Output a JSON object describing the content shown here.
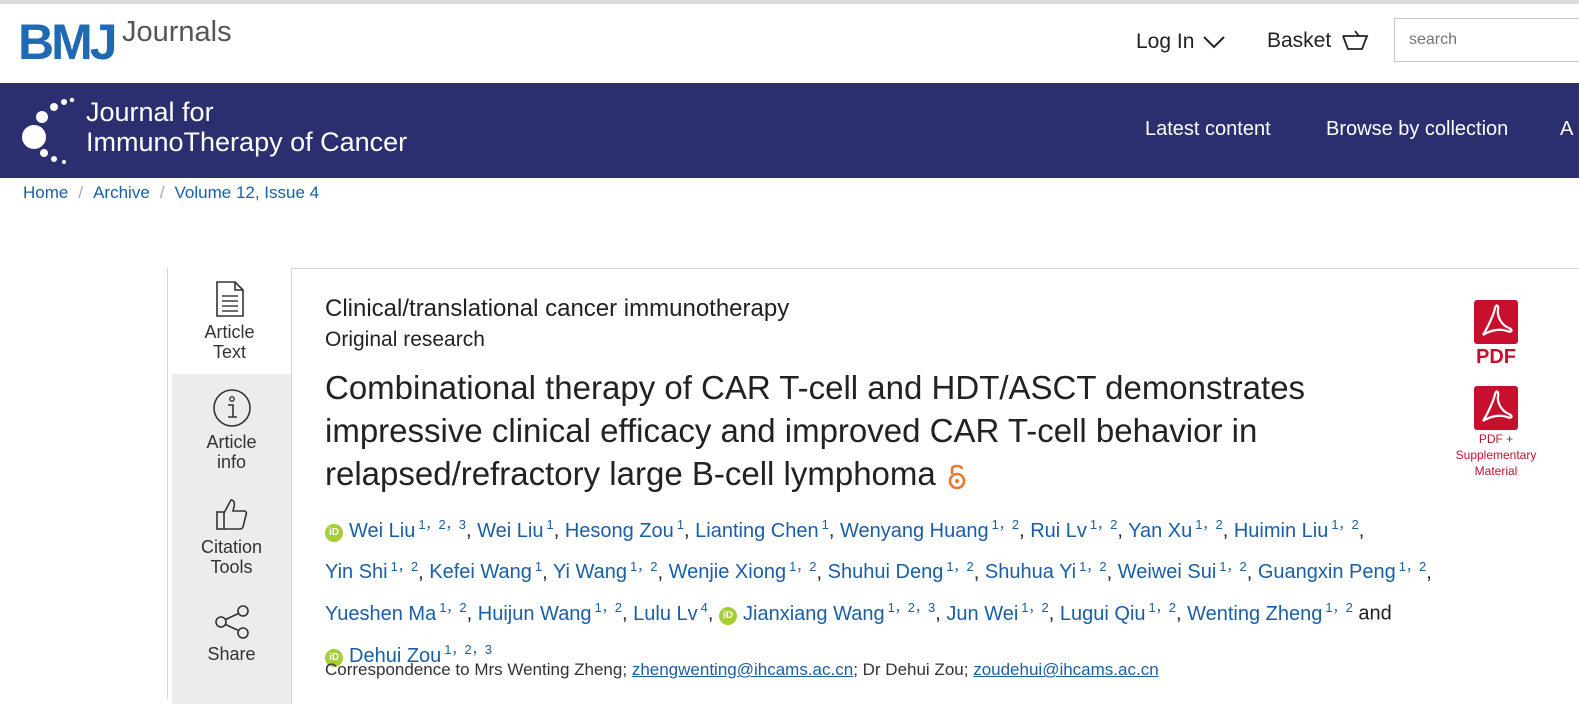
{
  "header": {
    "brand": "BMJ",
    "brand_suffix": "Journals",
    "login_label": "Log In",
    "basket_label": "Basket",
    "search_placeholder": "search"
  },
  "journal": {
    "title_line1": "Journal for",
    "title_line2": "ImmunoTherapy of Cancer",
    "nav": [
      "Latest content",
      "Browse by collection",
      "A"
    ]
  },
  "breadcrumb": [
    "Home",
    "Archive",
    "Volume 12, Issue 4"
  ],
  "sidebar": {
    "tabs": [
      {
        "line1": "Article",
        "line2": "Text",
        "icon": "document-icon"
      },
      {
        "line1": "Article",
        "line2": "info",
        "icon": "info-icon"
      },
      {
        "line1": "Citation",
        "line2": "Tools",
        "icon": "thumbs-up-icon"
      },
      {
        "line1": "Share",
        "line2": "",
        "icon": "share-icon"
      }
    ]
  },
  "article": {
    "section": "Clinical/translational cancer immunotherapy",
    "type": "Original research",
    "title": "Combinational therapy of CAR T-cell and HDT/ASCT demonstrates impressive clinical efficacy and improved CAR T-cell behavior in relapsed/refractory large B-cell lymphoma",
    "authors": [
      {
        "name": "Wei Liu",
        "aff": "1，2，3",
        "orcid": true
      },
      {
        "name": "Wei Liu",
        "aff": "1",
        "orcid": false
      },
      {
        "name": "Hesong Zou",
        "aff": "1",
        "orcid": false
      },
      {
        "name": "Lianting Chen",
        "aff": "1",
        "orcid": false
      },
      {
        "name": "Wenyang Huang",
        "aff": "1，2",
        "orcid": false
      },
      {
        "name": "Rui Lv",
        "aff": "1，2",
        "orcid": false
      },
      {
        "name": "Yan Xu",
        "aff": "1，2",
        "orcid": false
      },
      {
        "name": "Huimin Liu",
        "aff": "1，2",
        "orcid": false
      },
      {
        "name": "Yin Shi",
        "aff": "1，2",
        "orcid": false
      },
      {
        "name": "Kefei Wang",
        "aff": "1",
        "orcid": false
      },
      {
        "name": "Yi Wang",
        "aff": "1，2",
        "orcid": false
      },
      {
        "name": "Wenjie Xiong",
        "aff": "1，2",
        "orcid": false
      },
      {
        "name": "Shuhui Deng",
        "aff": "1，2",
        "orcid": false
      },
      {
        "name": "Shuhua Yi",
        "aff": "1，2",
        "orcid": false
      },
      {
        "name": "Weiwei Sui",
        "aff": "1，2",
        "orcid": false
      },
      {
        "name": "Guangxin Peng",
        "aff": "1，2",
        "orcid": false
      },
      {
        "name": "Yueshen Ma",
        "aff": "1，2",
        "orcid": false
      },
      {
        "name": "Huijun Wang",
        "aff": "1，2",
        "orcid": false
      },
      {
        "name": "Lulu Lv",
        "aff": "4",
        "orcid": false
      },
      {
        "name": "Jianxiang Wang",
        "aff": "1，2，3",
        "orcid": true
      },
      {
        "name": "Jun Wei",
        "aff": "1，2",
        "orcid": false
      },
      {
        "name": "Lugui Qiu",
        "aff": "1，2",
        "orcid": false
      },
      {
        "name": "Wenting Zheng",
        "aff": "1，2",
        "orcid": false
      },
      {
        "name": "Dehui Zou",
        "aff": "1，2，3",
        "orcid": true
      }
    ],
    "and_word": "and",
    "correspondence": {
      "prefix": "Correspondence to Mrs Wenting Zheng;",
      "email1": "zhengwenting@ihcams.ac.cn",
      "middle": "; Dr Dehui Zou;",
      "email2": "zoudehui@ihcams.ac.cn"
    }
  },
  "downloads": {
    "pdf_label": "PDF",
    "pdf_supp_line1": "PDF +",
    "pdf_supp_line2": "Supplementary",
    "pdf_supp_line3": "Material"
  },
  "colors": {
    "journal_bar": "#2b2f6f",
    "link": "#1a5fa6",
    "pdf_red": "#c8102e",
    "orcid_green": "#a6ce39",
    "brand_blue": "#1f6bb3"
  }
}
